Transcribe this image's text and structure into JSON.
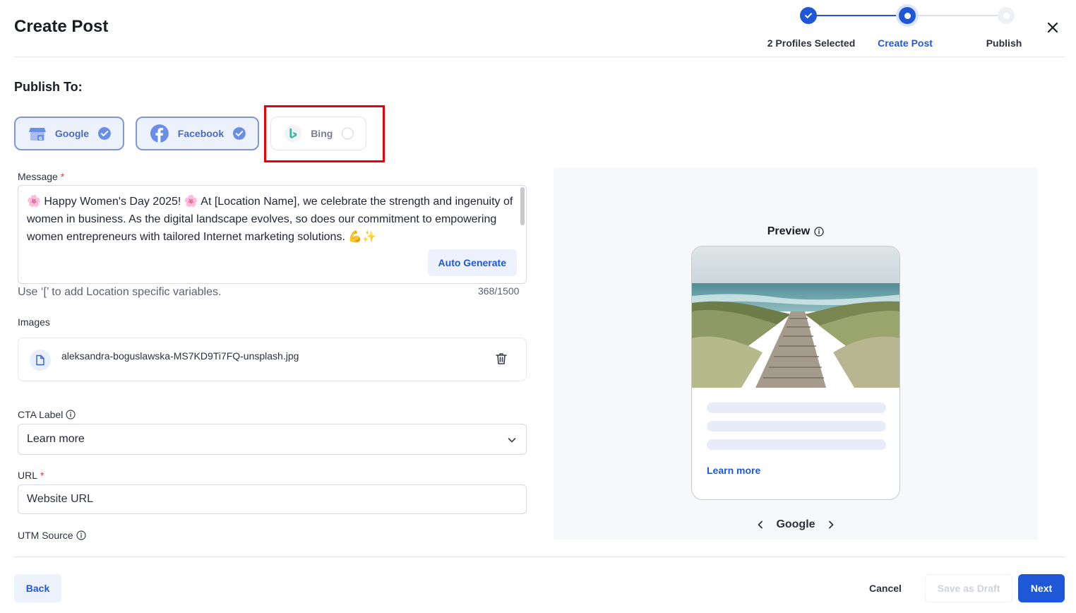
{
  "header": {
    "title": "Create Post",
    "close_label": "close"
  },
  "stepper": {
    "steps": [
      {
        "label": "2 Profiles Selected",
        "state": "done"
      },
      {
        "label": "Create Post",
        "state": "current"
      },
      {
        "label": "Publish",
        "state": "pending"
      }
    ]
  },
  "publish_to": {
    "heading": "Publish To:",
    "profiles": [
      {
        "label": "Google",
        "selected": true,
        "icon": "google-business-icon"
      },
      {
        "label": "Facebook",
        "selected": true,
        "icon": "facebook-icon"
      },
      {
        "label": "Bing",
        "selected": false,
        "icon": "bing-icon"
      }
    ]
  },
  "message": {
    "label": "Message",
    "required_mark": "*",
    "text": "🌸 Happy Women's Day 2025! 🌸 At [Location Name], we celebrate the strength and ingenuity of women in business. As the digital landscape evolves, so does our commitment to empowering women entrepreneurs with tailored Internet marketing solutions. 💪✨",
    "auto_generate_label": "Auto Generate",
    "hint": "Use ‘[’ to add Location specific variables.",
    "counter": "368/1500"
  },
  "images": {
    "label": "Images",
    "files": [
      {
        "name": "aleksandra-boguslawska-MS7KD9Ti7FQ-unsplash.jpg"
      }
    ]
  },
  "cta": {
    "label": "CTA Label",
    "selected": "Learn more"
  },
  "url": {
    "label": "URL",
    "required_mark": "*",
    "placeholder": "Website URL"
  },
  "utm": {
    "label": "UTM Source"
  },
  "preview": {
    "title": "Preview",
    "cta_link": "Learn more",
    "platform": "Google"
  },
  "footer": {
    "back_label": "Back",
    "cancel_label": "Cancel",
    "draft_label": "Save as Draft",
    "next_label": "Next"
  },
  "colors": {
    "accent": "#1f58d6",
    "highlight": "#e8000b",
    "chip_selected_bg": "#edf1fb",
    "preview_bg": "#f7f8fa"
  }
}
